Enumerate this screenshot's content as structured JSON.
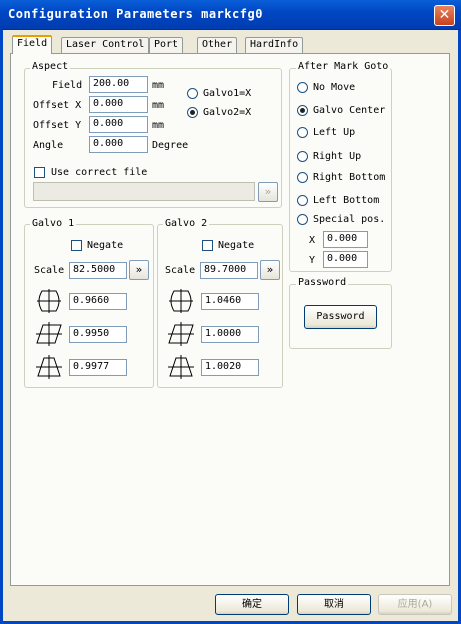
{
  "window": {
    "title": "Configuration Parameters markcfg0",
    "close_glyph": "✕"
  },
  "tabs": [
    {
      "label": "Field",
      "active": true
    },
    {
      "label": "Laser Control"
    },
    {
      "label": "Port"
    },
    {
      "label": "Other"
    },
    {
      "label": "HardInfo"
    }
  ],
  "aspect": {
    "title": "Aspect",
    "field_label": "Field",
    "field_value": "200.00",
    "field_unit": "mm",
    "offset_x_label": "Offset X",
    "offset_x_value": "0.000",
    "offset_x_unit": "mm",
    "offset_y_label": "Offset Y",
    "offset_y_value": "0.000",
    "offset_y_unit": "mm",
    "angle_label": "Angle",
    "angle_value": "0.000",
    "angle_unit": "Degree",
    "galvo1_x_label": "Galvo1=X",
    "galvo2_x_label": "Galvo2=X",
    "selected_galvo": "Galvo2=X",
    "use_correct_file_label": "Use correct file",
    "use_correct_file_checked": false,
    "correct_file_path": "",
    "browse_glyph": "»"
  },
  "galvo1": {
    "title": "Galvo 1",
    "negate_label": "Negate",
    "negate_checked": false,
    "scale_label": "Scale",
    "scale_value": "82.5000",
    "scale_button_glyph": "»",
    "coef1": "0.9660",
    "coef2": "0.9950",
    "coef3": "0.9977"
  },
  "galvo2": {
    "title": "Galvo 2",
    "negate_label": "Negate",
    "negate_checked": false,
    "scale_label": "Scale",
    "scale_value": "89.7000",
    "scale_button_glyph": "»",
    "coef1": "1.0460",
    "coef2": "1.0000",
    "coef3": "1.0020"
  },
  "after_mark": {
    "title": "After Mark Goto",
    "options": [
      "No Move",
      "Galvo Center",
      "Left Up",
      "Right Up",
      "Right Bottom",
      "Left Bottom",
      "Special pos."
    ],
    "selected": "Galvo Center",
    "x_label": "X",
    "x_value": "0.000",
    "y_label": "Y",
    "y_value": "0.000"
  },
  "password": {
    "title": "Password",
    "button_label": "Password"
  },
  "footer": {
    "ok_label": "确定",
    "cancel_label": "取消",
    "apply_label": "应用(A)"
  },
  "colors": {
    "titlebar": "#0047c4",
    "dialog_bg": "#ece9d8",
    "panel_bg": "#fbfbf8",
    "radio_selected": "#21a121",
    "tab_highlight": "#e6a100"
  }
}
